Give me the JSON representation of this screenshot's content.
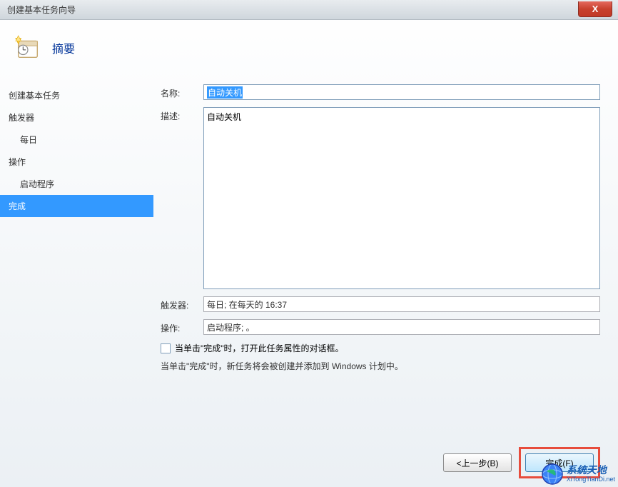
{
  "window": {
    "title": "创建基本任务向导",
    "close_label": "X"
  },
  "header": {
    "title": "摘要"
  },
  "sidebar": {
    "items": [
      {
        "label": "创建基本任务",
        "indent": 0
      },
      {
        "label": "触发器",
        "indent": 0
      },
      {
        "label": "每日",
        "indent": 1
      },
      {
        "label": "操作",
        "indent": 0
      },
      {
        "label": "启动程序",
        "indent": 1
      },
      {
        "label": "完成",
        "indent": 0,
        "active": true
      }
    ]
  },
  "form": {
    "name_label": "名称:",
    "name_value": "自动关机",
    "desc_label": "描述:",
    "desc_value": "自动关机",
    "trigger_label": "触发器:",
    "trigger_value": "每日; 在每天的 16:37",
    "action_label": "操作:",
    "action_value": "启动程序; 。",
    "checkbox_label": "当单击\"完成\"时，打开此任务属性的对话框。",
    "info_text": "当单击\"完成\"时，新任务将会被创建并添加到 Windows 计划中。"
  },
  "buttons": {
    "back": "<上一步(B)",
    "finish": "完成(F)"
  },
  "watermark": {
    "name": "系统天地",
    "url": "XiTongTianDi.net"
  }
}
